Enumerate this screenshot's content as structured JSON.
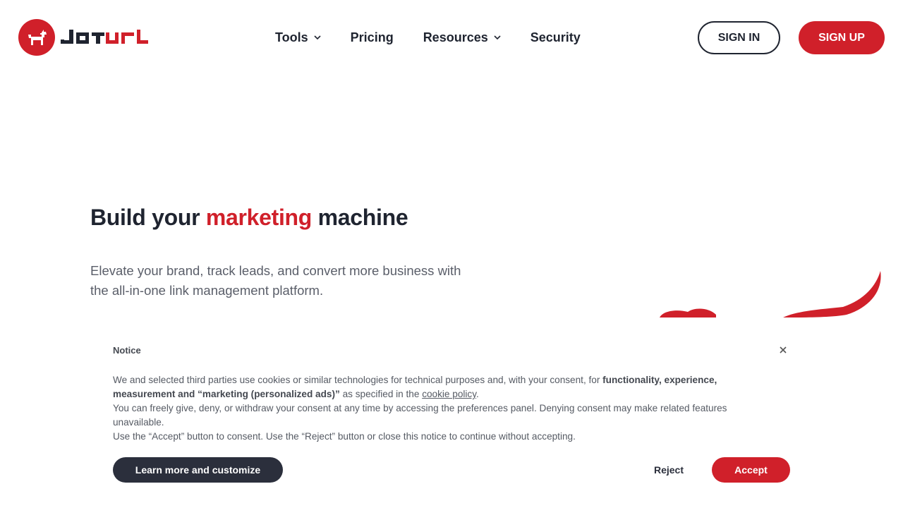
{
  "brand": {
    "logo_text": "JOTURL",
    "logo_icon": "dog-icon",
    "accent_color": "#d0202a",
    "dark_color": "#1f2430"
  },
  "nav": {
    "items": [
      {
        "label": "Tools",
        "has_dropdown": true
      },
      {
        "label": "Pricing",
        "has_dropdown": false
      },
      {
        "label": "Resources",
        "has_dropdown": true
      },
      {
        "label": "Security",
        "has_dropdown": false
      }
    ],
    "sign_in": "SIGN IN",
    "sign_up": "SIGN UP"
  },
  "hero": {
    "title_before": "Build your ",
    "title_accent": "marketing",
    "title_after": " machine",
    "subtitle": "Elevate your brand, track leads, and convert more business with the all-in-one link management platform."
  },
  "cookie": {
    "title": "Notice",
    "close_icon": "close-icon",
    "p1_text": "We and selected third parties use cookies or similar technologies for technical purposes and, with your consent, for ",
    "p1_bold": "functionality, experience, measurement and “marketing (personalized ads)”",
    "p1_mid": " as specified in the ",
    "p1_link": "cookie policy",
    "p1_end": ".",
    "p2": "You can freely give, deny, or withdraw your consent at any time by accessing the preferences panel. Denying consent may make related features unavailable.",
    "p3": "Use the “Accept” button to consent. Use the “Reject” button or close this notice to continue without accepting.",
    "learn_more": "Learn more and customize",
    "reject": "Reject",
    "accept": "Accept"
  }
}
